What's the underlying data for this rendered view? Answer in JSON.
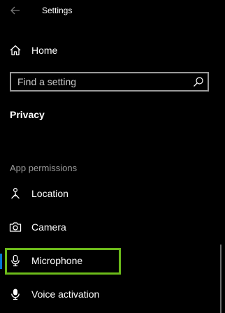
{
  "window": {
    "title": "Settings"
  },
  "nav": {
    "home_label": "Home"
  },
  "search": {
    "placeholder": "Find a setting"
  },
  "section": {
    "title": "Privacy"
  },
  "app_permissions": {
    "header": "App permissions",
    "items": [
      {
        "label": "Location",
        "icon": "location-icon"
      },
      {
        "label": "Camera",
        "icon": "camera-icon"
      },
      {
        "label": "Microphone",
        "icon": "microphone-icon",
        "selected": true
      },
      {
        "label": "Voice activation",
        "icon": "voice-activation-icon"
      }
    ]
  },
  "colors": {
    "background": "#000000",
    "text": "#ffffff",
    "muted_text": "#9b9b9b",
    "selection_indicator": "#0078d7",
    "highlight_outline": "#6cbb1a"
  }
}
